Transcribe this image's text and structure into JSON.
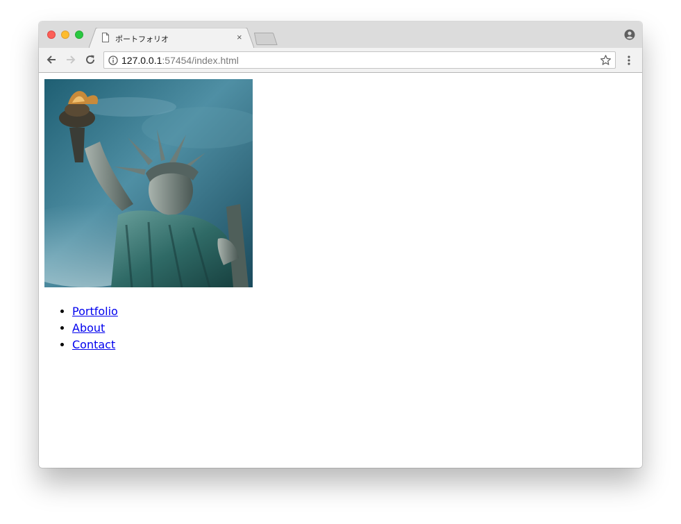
{
  "browser": {
    "tab": {
      "title": "ポートフォリオ",
      "close_glyph": "×",
      "icon": "document-icon"
    },
    "new_tab_icon": "new-tab-icon",
    "profile_icon": "profile-icon",
    "toolbar": {
      "back_icon": "back-arrow-icon",
      "forward_icon": "forward-arrow-icon",
      "reload_icon": "reload-icon",
      "info_icon": "info-icon",
      "bookmark_icon": "star-icon",
      "menu_icon": "menu-dots-icon"
    },
    "address": {
      "host": "127.0.0.1",
      "rest": ":57454/index.html"
    },
    "colors": {
      "titlebar": "#dcdcdc",
      "toolbar": "#f2f2f2",
      "close": "#fc5f57",
      "minimize": "#fdbc2e",
      "zoom": "#28c840",
      "link": "#0000ee"
    }
  },
  "page": {
    "hero_image": "statue-of-liberty-photo",
    "nav": {
      "items": [
        {
          "label": "Portfolio"
        },
        {
          "label": "About"
        },
        {
          "label": "Contact"
        }
      ]
    }
  }
}
